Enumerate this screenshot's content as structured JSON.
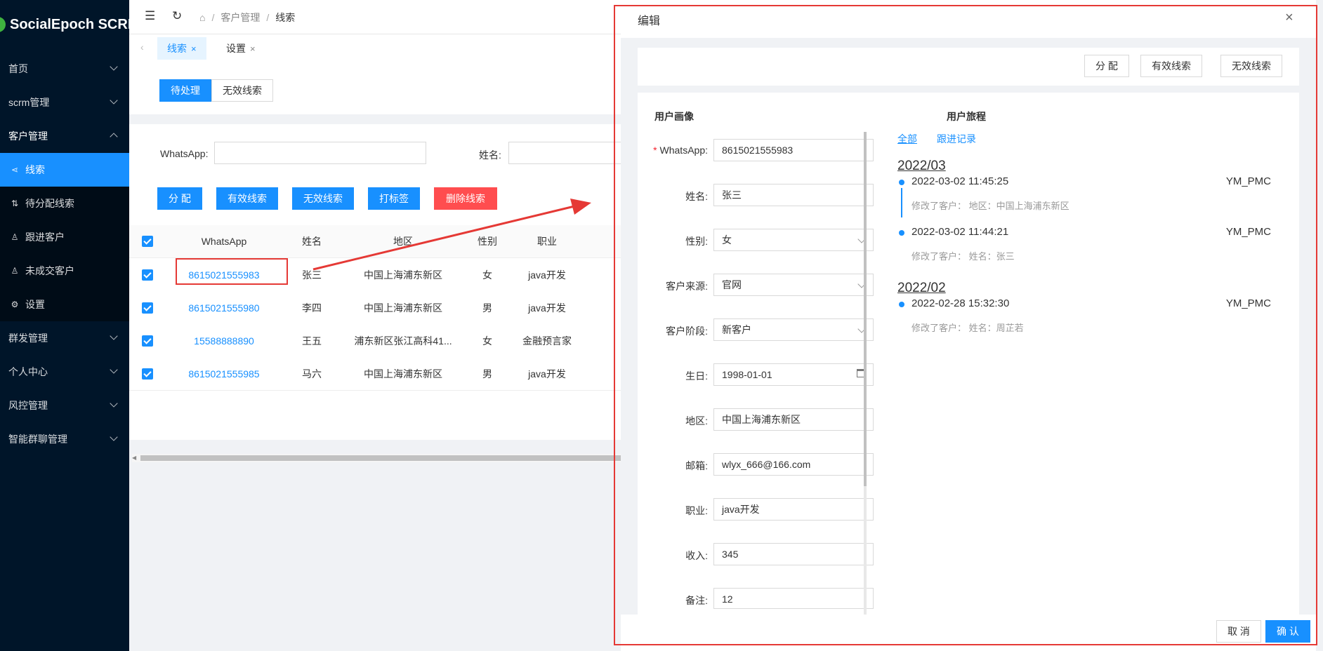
{
  "app": {
    "logo_text": "SocialEpoch SCRM"
  },
  "sidebar": {
    "items": [
      {
        "label": "首页"
      },
      {
        "label": "scrm管理"
      },
      {
        "label": "客户管理"
      },
      {
        "label": "群发管理"
      },
      {
        "label": "个人中心"
      },
      {
        "label": "风控管理"
      },
      {
        "label": "智能群聊管理"
      }
    ],
    "sub_items": [
      {
        "label": "线索",
        "icon": "share-icon"
      },
      {
        "label": "待分配线索",
        "icon": "flow-icon"
      },
      {
        "label": "跟进客户",
        "icon": "user-icon"
      },
      {
        "label": "未成交客户",
        "icon": "user-icon"
      },
      {
        "label": "设置",
        "icon": "gear-icon"
      }
    ]
  },
  "header": {
    "breadcrumb": [
      "客户管理",
      "线索"
    ]
  },
  "tabs": [
    {
      "label": "线索",
      "close": "×"
    },
    {
      "label": "设置",
      "close": "×"
    }
  ],
  "segment": {
    "pending": "待处理",
    "invalid": "无效线索"
  },
  "filters": {
    "whatsapp_label": "WhatsApp:",
    "name_label": "姓名:"
  },
  "actions": {
    "assign": "分 配",
    "valid": "有效线索",
    "invalid": "无效线索",
    "tag": "打标签",
    "delete": "删除线索"
  },
  "table": {
    "headers": [
      "WhatsApp",
      "姓名",
      "地区",
      "性别",
      "职业"
    ],
    "rows": [
      {
        "whatsapp": "8615021555983",
        "name": "张三",
        "region": "中国上海浦东新区",
        "gender": "女",
        "job": "java开发"
      },
      {
        "whatsapp": "8615021555980",
        "name": "李四",
        "region": "中国上海浦东新区",
        "gender": "男",
        "job": "java开发"
      },
      {
        "whatsapp": "15588888890",
        "name": "王五",
        "region": "浦东新区张江高科41...",
        "gender": "女",
        "job": "金融预言家"
      },
      {
        "whatsapp": "8615021555985",
        "name": "马六",
        "region": "中国上海浦东新区",
        "gender": "男",
        "job": "java开发"
      }
    ]
  },
  "dialog": {
    "title": "编辑",
    "close": "×",
    "actions": {
      "assign": "分 配",
      "valid": "有效线索",
      "invalid": "无效线索"
    },
    "profile_title": "用户画像",
    "journey_title": "用户旅程",
    "form": [
      {
        "label": "WhatsApp:",
        "value": "8615021555983",
        "required": true
      },
      {
        "label": "姓名:",
        "value": "张三"
      },
      {
        "label": "性别:",
        "value": "女",
        "type": "select"
      },
      {
        "label": "客户来源:",
        "value": "官网",
        "type": "select"
      },
      {
        "label": "客户阶段:",
        "value": "新客户",
        "type": "select"
      },
      {
        "label": "生日:",
        "value": "1998-01-01",
        "type": "date"
      },
      {
        "label": "地区:",
        "value": "中国上海浦东新区"
      },
      {
        "label": "邮箱:",
        "value": "wlyx_666@166.com"
      },
      {
        "label": "职业:",
        "value": "java开发"
      },
      {
        "label": "收入:",
        "value": "345"
      },
      {
        "label": "备注:",
        "value": "12"
      }
    ],
    "journey_links": {
      "all": "全部",
      "follow": "跟进记录"
    },
    "journey": [
      {
        "month": "2022/03",
        "events": [
          {
            "time": "2022-03-02 11:45:25",
            "user": "YM_PMC",
            "desc": "修改了客户： 地区：中国上海浦东新区"
          },
          {
            "time": "2022-03-02 11:44:21",
            "user": "YM_PMC",
            "desc": "修改了客户： 姓名：张三"
          }
        ]
      },
      {
        "month": "2022/02",
        "events": [
          {
            "time": "2022-02-28 15:32:30",
            "user": "YM_PMC",
            "desc": "修改了客户： 姓名：周芷若"
          }
        ]
      }
    ],
    "footer": {
      "cancel": "取 消",
      "confirm": "确 认"
    }
  }
}
